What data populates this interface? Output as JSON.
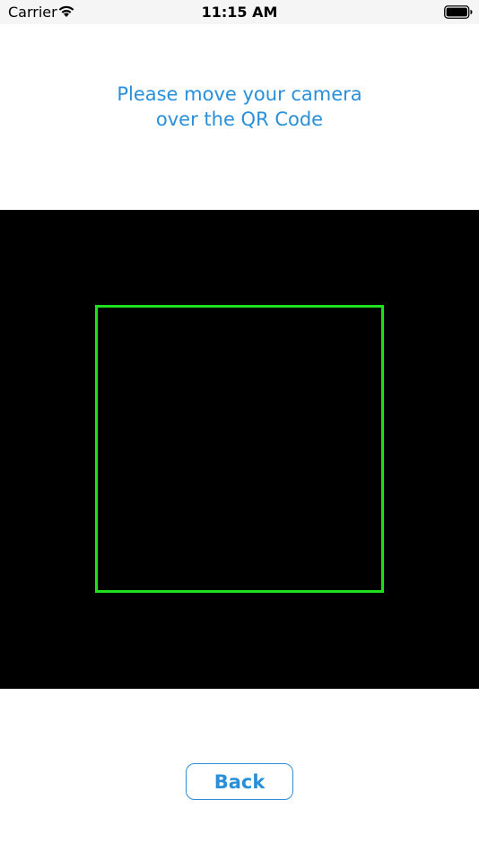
{
  "status_bar": {
    "carrier": "Carrier",
    "time": "11:15 AM",
    "icons": [
      "wifi-icon",
      "battery-icon"
    ]
  },
  "instruction": {
    "line1": "Please move your camera",
    "line2": "over the QR Code"
  },
  "scanner": {
    "frame_color": "#1ee01e",
    "background_color": "#000000"
  },
  "back_button": {
    "label": "Back"
  },
  "colors": {
    "accent": "#2a8fd9"
  }
}
